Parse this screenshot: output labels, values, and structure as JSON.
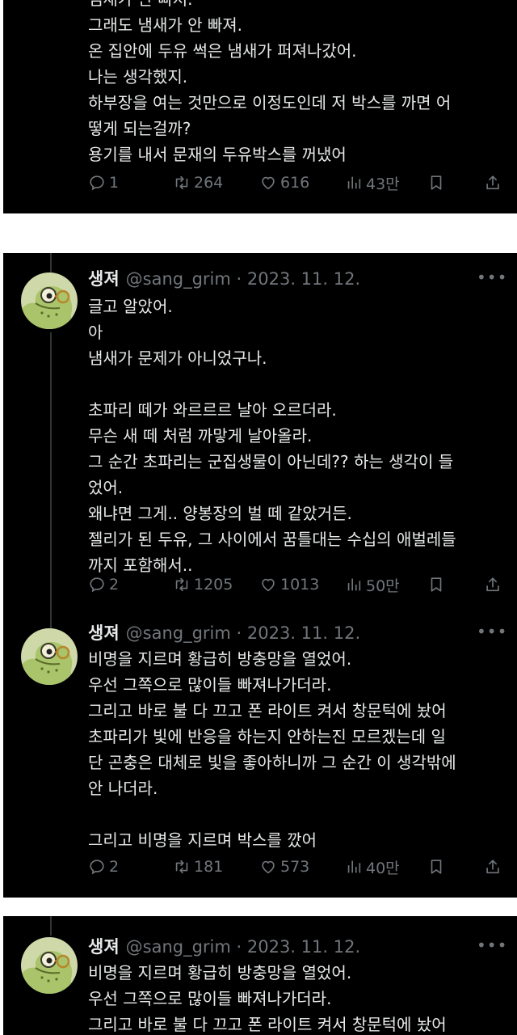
{
  "panel1": {
    "lines": [
      "냄새가 안 빠져.",
      "그래도 냄새가 안 빠져.",
      "온 집안에 두유 썩은 냄새가 퍼져나갔어.",
      "나는 생각했지.",
      "하부장을 여는 것만으로 이정도인데 저 박스를 까면 어",
      "떻게 되는걸까?",
      "용기를 내서 문재의 두유박스를 꺼냈어"
    ],
    "stats": {
      "replies": "1",
      "retweets": "264",
      "likes": "616",
      "views": "43만"
    }
  },
  "tweet2": {
    "name": "생져",
    "handle": "@sang_grim · 2023. 11. 12.",
    "lines": [
      "글고 알았어.",
      "아",
      "냄새가 문제가 아니었구나.",
      "",
      "초파리 떼가 와르르르 날아 오르더라.",
      "무슨 새 떼 처럼 까맣게 날아올라.",
      "그 순간 초파리는 군집생물이 아닌데?? 하는 생각이 들",
      "었어.",
      "왜냐면 그게.. 양봉장의 벌 떼 같았거든.",
      "젤리가 된 두유, 그 사이에서 꿈틀대는 수십의 애벌레들",
      "까지 포함해서.."
    ],
    "stats": {
      "replies": "2",
      "retweets": "1205",
      "likes": "1013",
      "views": "50만"
    }
  },
  "tweet3": {
    "name": "생져",
    "handle": "@sang_grim · 2023. 11. 12.",
    "lines": [
      "비명을 지르며 황급히 방충망을 열었어.",
      "우선 그쪽으로 많이들 빠져나가더라.",
      "그리고 바로 불 다 끄고 폰 라이트 켜서 창문턱에 놨어",
      "초파리가 빛에 반응을 하는지 안하는진 모르겠는데 일",
      "단 곤충은 대체로 빛을 좋아하니까 그 순간 이 생각밖에",
      "안 나더라.",
      "",
      "그리고 비명을 지르며 박스를 깠어"
    ],
    "stats": {
      "replies": "2",
      "retweets": "181",
      "likes": "573",
      "views": "40만"
    }
  },
  "tweet4": {
    "name": "생져",
    "handle": "@sang_grim · 2023. 11. 12.",
    "lines": [
      "비명을 지르며 황급히 방충망을 열었어.",
      "우선 그쪽으로 많이들 빠져나가더라.",
      "그리고 바로 불 다 끄고 폰 라이트 켜서 창문턱에 놨어"
    ]
  },
  "more_glyph": "•••",
  "colors": {
    "background": "#000000",
    "text": "#e7e9ea",
    "muted": "#71767b",
    "separator": "#ffffff"
  }
}
